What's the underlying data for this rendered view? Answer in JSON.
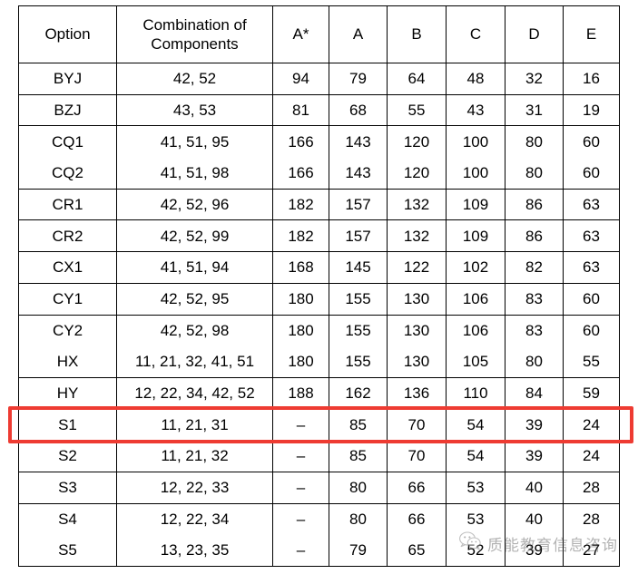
{
  "table": {
    "headers": [
      "Option",
      "Combination of Components",
      "A*",
      "A",
      "B",
      "C",
      "D",
      "E"
    ],
    "rows": [
      {
        "option": "BYJ",
        "combination": "42, 52",
        "astar": "94",
        "a": "79",
        "b": "64",
        "c": "48",
        "d": "32",
        "e": "16",
        "rule_top": true,
        "highlighted": false
      },
      {
        "option": "BZJ",
        "combination": "43, 53",
        "astar": "81",
        "a": "68",
        "b": "55",
        "c": "43",
        "d": "31",
        "e": "19",
        "rule_top": true,
        "highlighted": false
      },
      {
        "option": "CQ1",
        "combination": "41, 51, 95",
        "astar": "166",
        "a": "143",
        "b": "120",
        "c": "100",
        "d": "80",
        "e": "60",
        "rule_top": true,
        "highlighted": false
      },
      {
        "option": "CQ2",
        "combination": "41, 51, 98",
        "astar": "166",
        "a": "143",
        "b": "120",
        "c": "100",
        "d": "80",
        "e": "60",
        "rule_top": false,
        "highlighted": false
      },
      {
        "option": "CR1",
        "combination": "42, 52, 96",
        "astar": "182",
        "a": "157",
        "b": "132",
        "c": "109",
        "d": "86",
        "e": "63",
        "rule_top": true,
        "highlighted": false
      },
      {
        "option": "CR2",
        "combination": "42, 52, 99",
        "astar": "182",
        "a": "157",
        "b": "132",
        "c": "109",
        "d": "86",
        "e": "63",
        "rule_top": true,
        "highlighted": false
      },
      {
        "option": "CX1",
        "combination": "41, 51, 94",
        "astar": "168",
        "a": "145",
        "b": "122",
        "c": "102",
        "d": "82",
        "e": "63",
        "rule_top": true,
        "highlighted": false
      },
      {
        "option": "CY1",
        "combination": "42, 52, 95",
        "astar": "180",
        "a": "155",
        "b": "130",
        "c": "106",
        "d": "83",
        "e": "60",
        "rule_top": true,
        "highlighted": false
      },
      {
        "option": "CY2",
        "combination": "42, 52, 98",
        "astar": "180",
        "a": "155",
        "b": "130",
        "c": "106",
        "d": "83",
        "e": "60",
        "rule_top": true,
        "highlighted": false
      },
      {
        "option": "HX",
        "combination": "11, 21, 32, 41, 51",
        "astar": "180",
        "a": "155",
        "b": "130",
        "c": "105",
        "d": "80",
        "e": "55",
        "rule_top": false,
        "highlighted": false
      },
      {
        "option": "HY",
        "combination": "12, 22, 34, 42, 52",
        "astar": "188",
        "a": "162",
        "b": "136",
        "c": "110",
        "d": "84",
        "e": "59",
        "rule_top": true,
        "highlighted": false
      },
      {
        "option": "S1",
        "combination": "11, 21, 31",
        "astar": "–",
        "a": "85",
        "b": "70",
        "c": "54",
        "d": "39",
        "e": "24",
        "rule_top": true,
        "highlighted": true
      },
      {
        "option": "S2",
        "combination": "11, 21, 32",
        "astar": "–",
        "a": "85",
        "b": "70",
        "c": "54",
        "d": "39",
        "e": "24",
        "rule_top": true,
        "highlighted": false
      },
      {
        "option": "S3",
        "combination": "12, 22, 33",
        "astar": "–",
        "a": "80",
        "b": "66",
        "c": "53",
        "d": "40",
        "e": "28",
        "rule_top": true,
        "highlighted": false
      },
      {
        "option": "S4",
        "combination": "12, 22, 34",
        "astar": "–",
        "a": "80",
        "b": "66",
        "c": "53",
        "d": "40",
        "e": "28",
        "rule_top": true,
        "highlighted": false
      },
      {
        "option": "S5",
        "combination": "13, 23, 35",
        "astar": "–",
        "a": "79",
        "b": "65",
        "c": "52",
        "d": "39",
        "e": "27",
        "rule_top": false,
        "highlighted": false
      }
    ]
  },
  "highlight": {
    "color": "#ee3b32",
    "target_row_option": "S1"
  },
  "watermark": {
    "text": "质能教育信息咨询",
    "icon": "wechat-icon"
  }
}
